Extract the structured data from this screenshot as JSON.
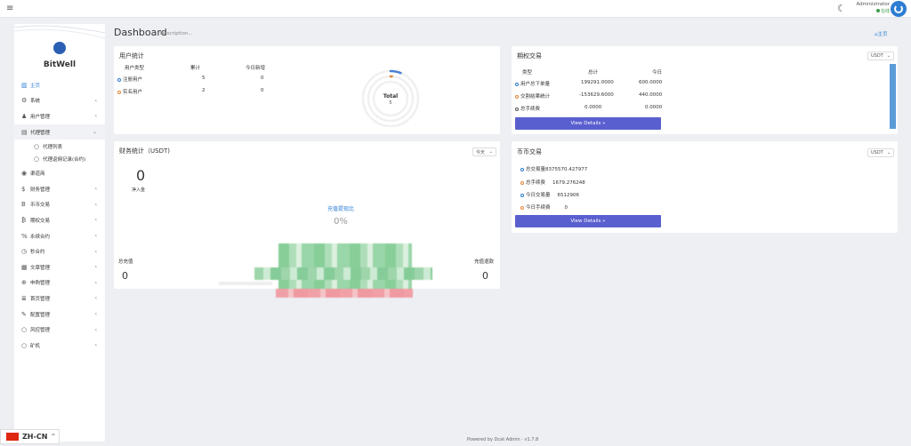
{
  "header": {
    "menu_icon": "≡",
    "admin_name": "Administrator",
    "status": "在线"
  },
  "sidebar": {
    "brand": "BitWell",
    "items": [
      {
        "label": "主页",
        "icon": "chart-bar-icon",
        "expandable": false
      },
      {
        "label": "系统",
        "icon": "gear-icon",
        "expandable": true
      },
      {
        "label": "用户管理",
        "icon": "user-icon",
        "expandable": true
      },
      {
        "label": "代理管理",
        "icon": "id-card-icon",
        "expandable": true
      },
      {
        "label": "代理列表",
        "sub": true
      },
      {
        "label": "代理返佣记录(合约)",
        "sub": true
      },
      {
        "label": "渠道商",
        "icon": "user-circle-icon",
        "expandable": false
      },
      {
        "label": "财务管理",
        "icon": "dollar-icon",
        "expandable": true
      },
      {
        "label": "币币交易",
        "icon": "bitcoin-icon",
        "expandable": true
      },
      {
        "label": "期权交易",
        "icon": "bitcoin-sign-icon",
        "expandable": true
      },
      {
        "label": "永续合约",
        "icon": "percent-icon",
        "expandable": true
      },
      {
        "label": "秒合约",
        "icon": "clock-icon",
        "expandable": true
      },
      {
        "label": "文章管理",
        "icon": "keyboard-icon",
        "expandable": true
      },
      {
        "label": "申购管理",
        "icon": "life-ring-icon",
        "expandable": true
      },
      {
        "label": "首页管理",
        "icon": "list-icon",
        "expandable": true
      },
      {
        "label": "配置管理",
        "icon": "wrench-icon",
        "expandable": true
      },
      {
        "label": "风控管理",
        "icon": "circle-icon",
        "expandable": true
      },
      {
        "label": "矿机",
        "icon": "circle-icon",
        "expandable": true
      }
    ],
    "language": "ZH-CN"
  },
  "page": {
    "title": "Dashboard",
    "description": "Description...",
    "home_link": "主页"
  },
  "user_stats": {
    "title": "用户统计",
    "headers": [
      "用户类型",
      "累计",
      "今日新增"
    ],
    "rows": [
      {
        "type": "注册用户",
        "total": "5",
        "today": "0"
      },
      {
        "type": "实名用户",
        "total": "2",
        "today": "0"
      }
    ],
    "donut_label": "Total",
    "donut_value": "5",
    "donut_series": [
      5,
      2
    ],
    "colors": {
      "registered": "#4c7fd6",
      "verified": "#e4863a"
    }
  },
  "options_trading": {
    "title": "期权交易",
    "currency": "USDT",
    "headers": [
      "类型",
      "总计",
      "今日"
    ],
    "rows": [
      {
        "type": "用户总下单量",
        "total": "199291.0000",
        "today": "600.0000"
      },
      {
        "type": "交割结果统计",
        "total": "-153629.6000",
        "today": "440.0000"
      },
      {
        "type": "总手续费",
        "total": "0.0000",
        "today": "0.0000"
      }
    ],
    "button": "View Details »"
  },
  "finance": {
    "title": "财务统计（USDT)",
    "period": "今天",
    "big_value": "0",
    "big_label": "净入金",
    "ratio_label": "充值提现比",
    "ratio_value": "0%",
    "total_deposit_label": "总充值",
    "total_deposit": "0",
    "withdraw_label": "充值退款",
    "withdraw": "0"
  },
  "spot_trading": {
    "title": "币币交易",
    "currency": "USDT",
    "rows": [
      {
        "label": "总交易量",
        "value": "8375570.427977"
      },
      {
        "label": "总手续费",
        "value": "1679.276248"
      },
      {
        "label": "今日交易量",
        "value": "6512906"
      },
      {
        "label": "今日手续费",
        "value": "0"
      }
    ],
    "button": "View Details »"
  },
  "footer": {
    "text": "Powered by Dcat Admin · v1.7.8"
  }
}
